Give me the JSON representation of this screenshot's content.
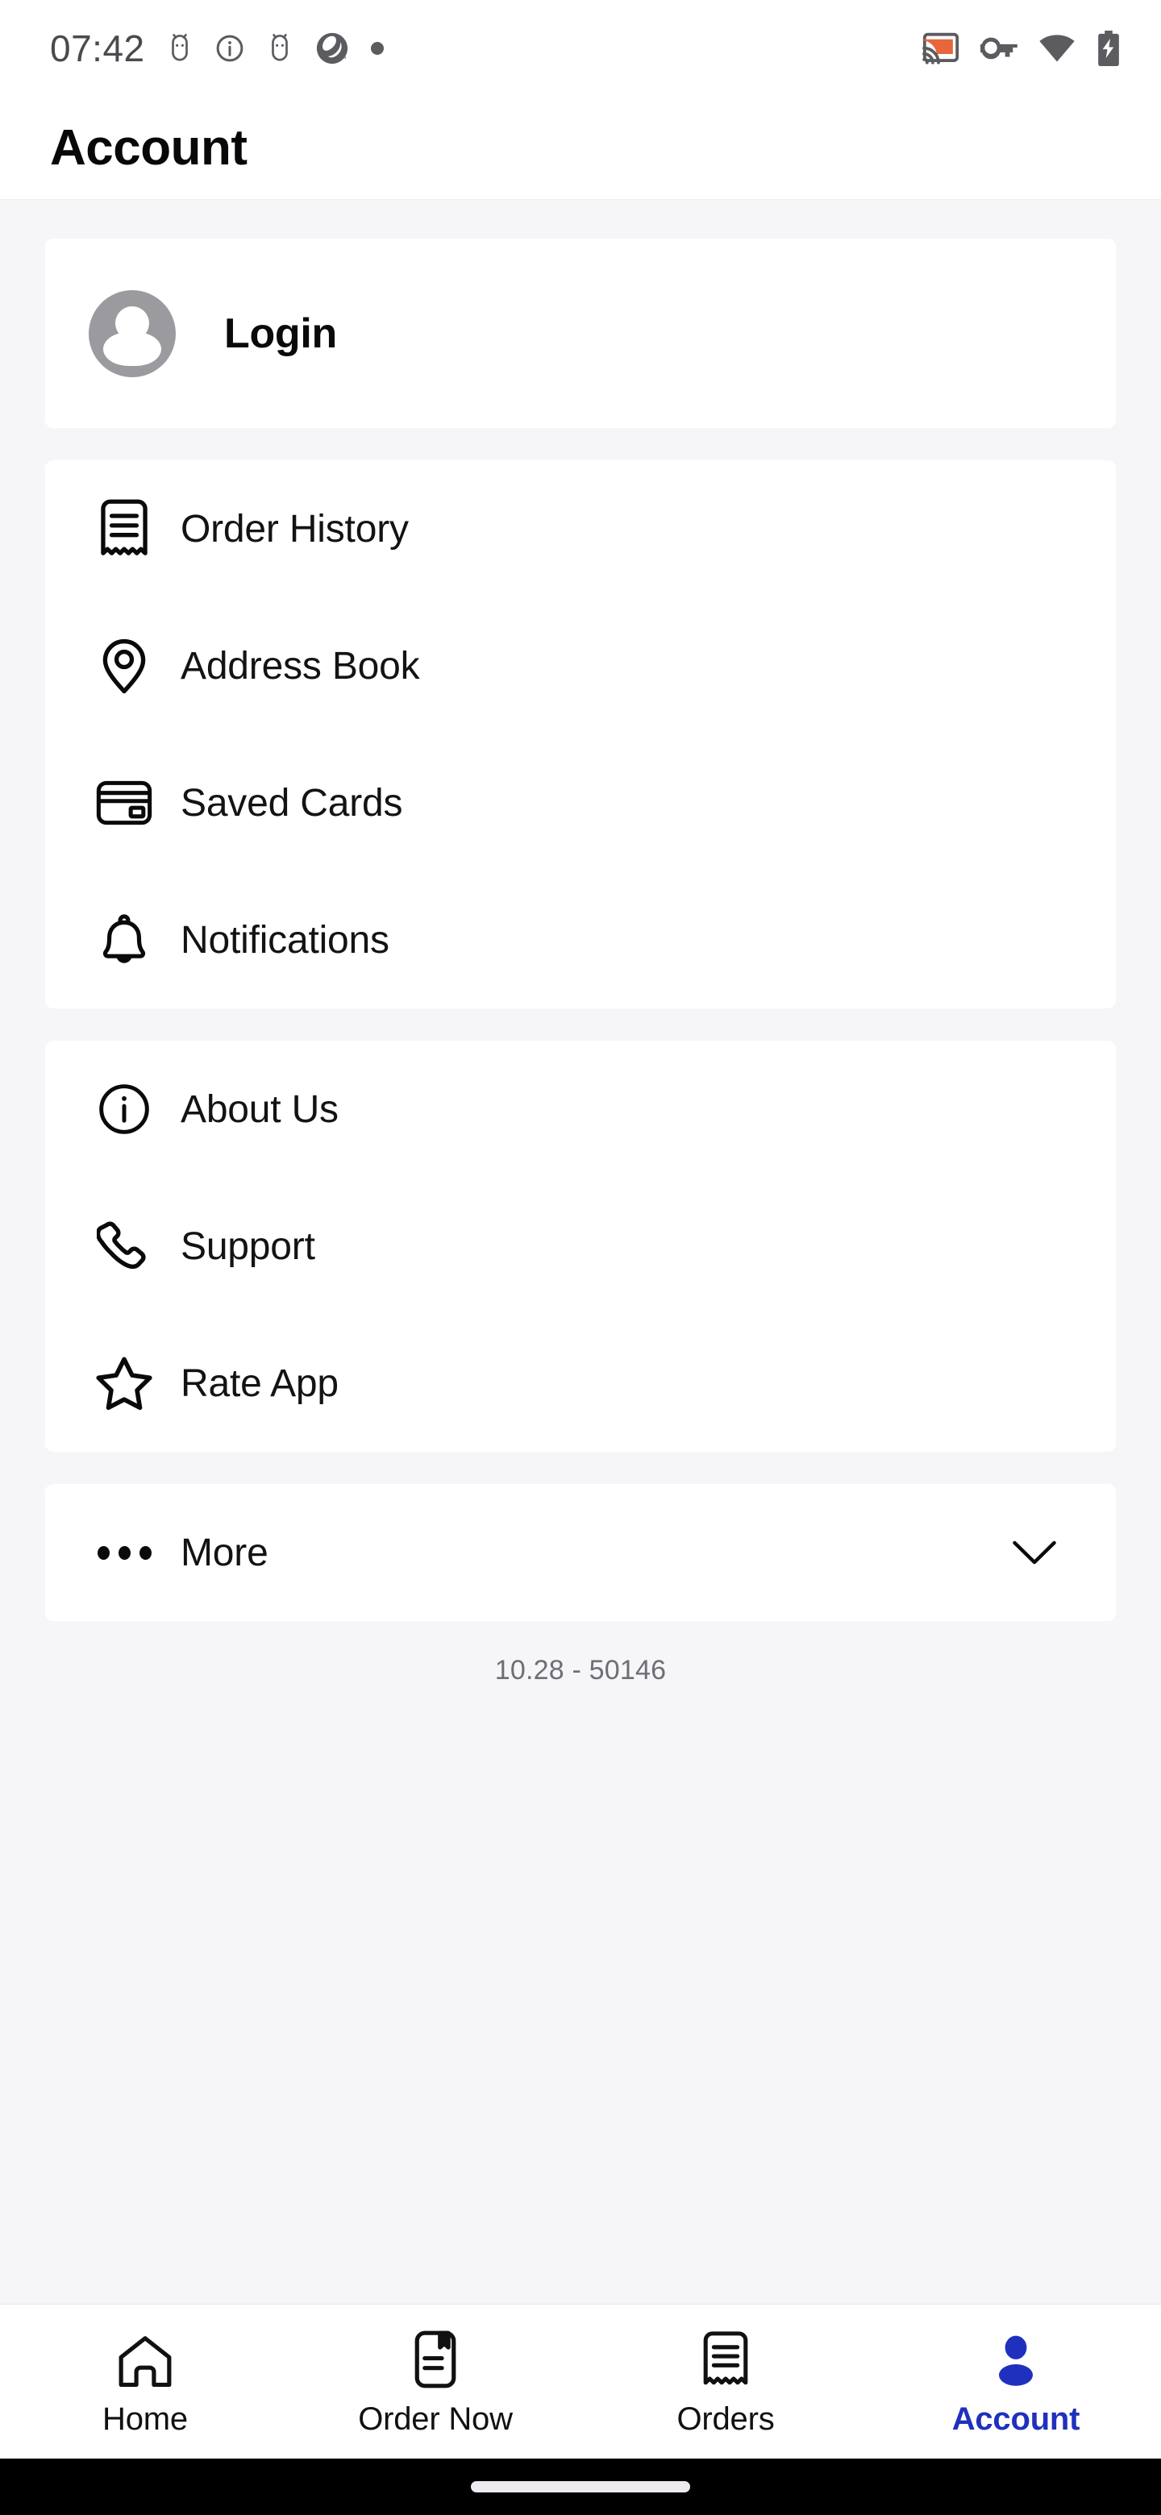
{
  "statusbar": {
    "time": "07:42",
    "left_icons": [
      "android-debug-icon",
      "info-circle-icon",
      "android-debug-icon",
      "camera-aperture-icon",
      "dot-icon"
    ],
    "right_icons": [
      "cast-icon",
      "vpn-key-icon",
      "wifi-icon",
      "battery-charging-icon"
    ],
    "cast_accent_color": "#E8663C",
    "icon_color": "#5B5B60"
  },
  "appbar": {
    "title": "Account"
  },
  "login": {
    "label": "Login",
    "avatar_icon": "person-avatar-icon"
  },
  "account_menu": {
    "items": [
      {
        "label": "Order History",
        "icon": "receipt-icon"
      },
      {
        "label": "Address Book",
        "icon": "location-pin-icon"
      },
      {
        "label": "Saved Cards",
        "icon": "credit-card-icon"
      },
      {
        "label": "Notifications",
        "icon": "bell-icon"
      }
    ]
  },
  "info_menu": {
    "items": [
      {
        "label": "About Us",
        "icon": "info-circle-icon"
      },
      {
        "label": "Support",
        "icon": "phone-icon"
      },
      {
        "label": "Rate App",
        "icon": "star-icon"
      }
    ]
  },
  "more": {
    "label": "More",
    "leading_icon": "ellipsis-icon",
    "trailing_icon": "chevron-down-icon",
    "expanded": false
  },
  "version": "10.28 - 50146",
  "bottom_nav": {
    "active_color": "#2030BE",
    "inactive_color": "#111114",
    "items": [
      {
        "label": "Home",
        "icon": "home-icon",
        "active": false
      },
      {
        "label": "Order Now",
        "icon": "menu-book-icon",
        "active": false
      },
      {
        "label": "Orders",
        "icon": "receipt-icon",
        "active": false
      },
      {
        "label": "Account",
        "icon": "person-icon",
        "active": true
      }
    ]
  }
}
